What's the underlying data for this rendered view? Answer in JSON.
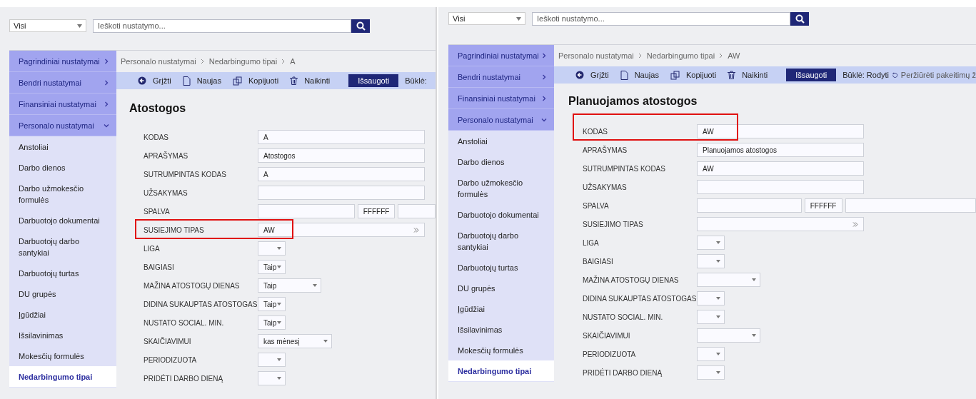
{
  "panels": [
    {
      "filter": "Visi",
      "search": {
        "placeholder": "Ieškoti nustatymo..."
      },
      "sidebar": [
        {
          "label": "Pagrindiniai nustatymai",
          "kind": "group",
          "expanded": false,
          "selected": false
        },
        {
          "label": "Bendri nustatymai",
          "kind": "group",
          "expanded": false,
          "selected": false
        },
        {
          "label": "Finansiniai nustatymai",
          "kind": "group",
          "expanded": false,
          "selected": false
        },
        {
          "label": "Personalo nustatymai",
          "kind": "group",
          "expanded": true,
          "selected": false
        },
        {
          "label": "Anstoliai",
          "kind": "item",
          "selected": false
        },
        {
          "label": "Darbo dienos",
          "kind": "item",
          "selected": false
        },
        {
          "label": "Darbo užmokesčio formulės",
          "kind": "item",
          "selected": false
        },
        {
          "label": "Darbuotojo dokumentai",
          "kind": "item",
          "selected": false
        },
        {
          "label": "Darbuotojų darbo santykiai",
          "kind": "item",
          "selected": false
        },
        {
          "label": "Darbuotojų turtas",
          "kind": "item",
          "selected": false
        },
        {
          "label": "DU grupės",
          "kind": "item",
          "selected": false
        },
        {
          "label": "Įgūdžiai",
          "kind": "item",
          "selected": false
        },
        {
          "label": "Išsilavinimas",
          "kind": "item",
          "selected": false
        },
        {
          "label": "Mokesčių formulės",
          "kind": "item",
          "selected": false
        },
        {
          "label": "Nedarbingumo tipai",
          "kind": "item",
          "selected": true
        }
      ],
      "breadcrumbs": [
        "Personalo nustatymai",
        "Nedarbingumo tipai",
        "A"
      ],
      "actions": [
        {
          "label": "Grįžti",
          "kind": "back"
        },
        {
          "label": "Naujas",
          "kind": "new"
        },
        {
          "label": "Kopijuoti",
          "kind": "copy"
        },
        {
          "label": "Naikinti",
          "kind": "delete"
        }
      ],
      "save": "Išsaugoti",
      "status": "Būklė:",
      "title": "Atostogos",
      "fields": [
        {
          "label": "KODAS",
          "kind": "text",
          "value": "A",
          "highlight": false
        },
        {
          "label": "APRAŠYMAS",
          "kind": "text",
          "value": "Atostogos",
          "highlight": false
        },
        {
          "label": "SUTRUMPINTAS KODAS",
          "kind": "text",
          "value": "A",
          "highlight": false
        },
        {
          "label": "UŽSAKYMAS",
          "kind": "text",
          "highlight": false
        },
        {
          "label": "SPALVA",
          "kind": "color",
          "value": "FFFFFF",
          "highlight": false
        },
        {
          "label": "SUSIEJIMO TIPAS",
          "kind": "lookup",
          "value": "AW",
          "highlight": true
        },
        {
          "label": "LIGA",
          "kind": "toggle",
          "highlight": false
        },
        {
          "label": "BAIGIASI",
          "kind": "toggle",
          "value": "Taip",
          "highlight": false
        },
        {
          "label": "MAŽINA ATOSTOGŲ DIENAS",
          "kind": "select",
          "value": "Taip",
          "highlight": false
        },
        {
          "label": "DIDINA SUKAUPTAS ATOSTOGAS",
          "kind": "toggle",
          "value": "Taip",
          "highlight": false
        },
        {
          "label": "NUSTATO SOCIAL. MIN.",
          "kind": "toggle",
          "value": "Taip",
          "highlight": false
        },
        {
          "label": "SKAIČIAVIMUI",
          "kind": "select",
          "value": "kas mėnesį",
          "highlight": false
        },
        {
          "label": "PERIODIZUOTA",
          "kind": "toggle",
          "highlight": false
        },
        {
          "label": "PRIDĖTI DARBO DIENĄ",
          "kind": "toggle",
          "highlight": false
        }
      ]
    },
    {
      "filter": "Visi",
      "search": {
        "placeholder": "Ieškoti nustatymo..."
      },
      "sidebar": [
        {
          "label": "Pagrindiniai nustatymai",
          "kind": "group",
          "expanded": false,
          "selected": false
        },
        {
          "label": "Bendri nustatymai",
          "kind": "group",
          "expanded": false,
          "selected": false
        },
        {
          "label": "Finansiniai nustatymai",
          "kind": "group",
          "expanded": false,
          "selected": false
        },
        {
          "label": "Personalo nustatymai",
          "kind": "group",
          "expanded": true,
          "selected": false
        },
        {
          "label": "Anstoliai",
          "kind": "item",
          "selected": false
        },
        {
          "label": "Darbo dienos",
          "kind": "item",
          "selected": false
        },
        {
          "label": "Darbo užmokesčio formulės",
          "kind": "item",
          "selected": false
        },
        {
          "label": "Darbuotojo dokumentai",
          "kind": "item",
          "selected": false
        },
        {
          "label": "Darbuotojų darbo santykiai",
          "kind": "item",
          "selected": false
        },
        {
          "label": "Darbuotojų turtas",
          "kind": "item",
          "selected": false
        },
        {
          "label": "DU grupės",
          "kind": "item",
          "selected": false
        },
        {
          "label": "Įgūdžiai",
          "kind": "item",
          "selected": false
        },
        {
          "label": "Išsilavinimas",
          "kind": "item",
          "selected": false
        },
        {
          "label": "Mokesčių formulės",
          "kind": "item",
          "selected": false
        },
        {
          "label": "Nedarbingumo tipai",
          "kind": "item",
          "selected": true
        }
      ],
      "breadcrumbs": [
        "Personalo nustatymai",
        "Nedarbingumo tipai",
        "AW"
      ],
      "actions": [
        {
          "label": "Grįžti",
          "kind": "back"
        },
        {
          "label": "Naujas",
          "kind": "new"
        },
        {
          "label": "Kopijuoti",
          "kind": "copy"
        },
        {
          "label": "Naikinti",
          "kind": "delete"
        }
      ],
      "save": "Išsaugoti",
      "status": "Būklė: Rodyti",
      "history": "Peržiūrėti pakeitimų ž",
      "title": "Planuojamos atostogos",
      "fields": [
        {
          "label": "KODAS",
          "kind": "text",
          "value": "AW",
          "highlight": true
        },
        {
          "label": "APRAŠYMAS",
          "kind": "text",
          "value": "Planuojamos atostogos",
          "highlight": false
        },
        {
          "label": "SUTRUMPINTAS KODAS",
          "kind": "text",
          "value": "AW",
          "highlight": false
        },
        {
          "label": "UŽSAKYMAS",
          "kind": "text",
          "highlight": false
        },
        {
          "label": "SPALVA",
          "kind": "color",
          "value": "FFFFFF",
          "highlight": false
        },
        {
          "label": "SUSIEJIMO TIPAS",
          "kind": "lookup",
          "highlight": false
        },
        {
          "label": "LIGA",
          "kind": "toggle",
          "highlight": false
        },
        {
          "label": "BAIGIASI",
          "kind": "toggle",
          "highlight": false
        },
        {
          "label": "MAŽINA ATOSTOGŲ DIENAS",
          "kind": "select",
          "highlight": false
        },
        {
          "label": "DIDINA SUKAUPTAS ATOSTOGAS",
          "kind": "toggle",
          "highlight": false
        },
        {
          "label": "NUSTATO SOCIAL. MIN.",
          "kind": "toggle",
          "highlight": false
        },
        {
          "label": "SKAIČIAVIMUI",
          "kind": "select",
          "highlight": false
        },
        {
          "label": "PERIODIZUOTA",
          "kind": "toggle",
          "highlight": false
        },
        {
          "label": "PRIDĖTI DARBO DIENĄ",
          "kind": "toggle",
          "highlight": false
        }
      ]
    }
  ]
}
